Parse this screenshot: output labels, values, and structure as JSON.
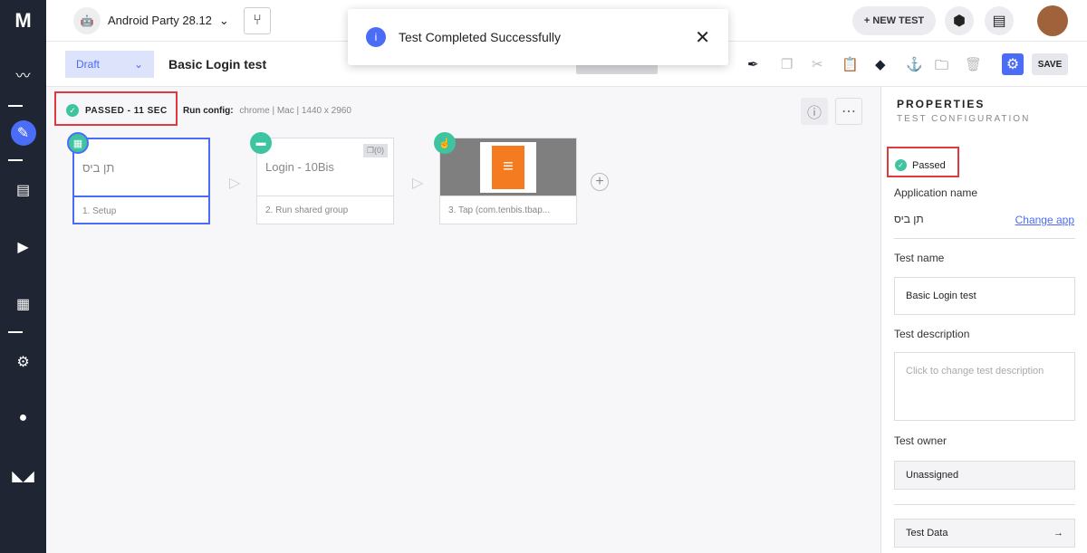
{
  "sidebar": {
    "logo": "M",
    "items": [
      "activity-icon",
      "edit-icon",
      "list-icon",
      "play-icon",
      "grid-icon",
      "gear-icon",
      "user-icon",
      "mask-icon"
    ]
  },
  "top": {
    "app_name": "Android Party 28.12",
    "new_test": "+ NEW TEST"
  },
  "toast": {
    "message": "Test Completed Successfully"
  },
  "toolbar": {
    "status": "Draft",
    "test_title": "Basic Login test",
    "save": "SAVE"
  },
  "run": {
    "status": "PASSED - 11 SEC",
    "config_label": "Run config:",
    "config_value": "chrome | Mac | 1440 x 2960"
  },
  "steps": [
    {
      "title": "תן ביס",
      "label": "1. Setup"
    },
    {
      "title": "Login - 10Bis",
      "label": "2. Run shared group",
      "count": "(0)"
    },
    {
      "title": "",
      "label": "3. Tap (com.tenbis.tbap..."
    }
  ],
  "properties": {
    "title": "PROPERTIES",
    "subtitle": "TEST CONFIGURATION",
    "status": "Passed",
    "app_name_label": "Application name",
    "app_name": "תן ביס",
    "change_app": "Change app",
    "test_name_label": "Test name",
    "test_name": "Basic Login test",
    "desc_label": "Test description",
    "desc_placeholder": "Click to change test description",
    "owner_label": "Test owner",
    "owner": "Unassigned",
    "test_data": "Test Data"
  },
  "colors": {
    "accent": "#4a6cf7",
    "success": "#3ec4a0",
    "highlight": "#e0393e",
    "sidebar": "#1f2532"
  }
}
